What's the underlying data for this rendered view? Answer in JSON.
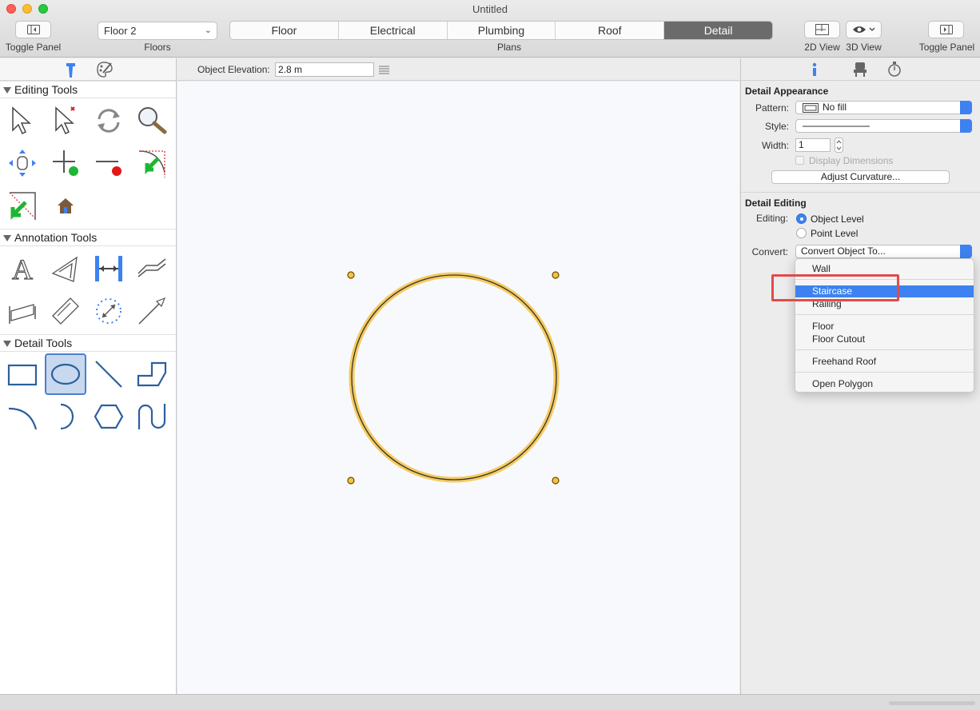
{
  "window": {
    "title": "Untitled"
  },
  "toolbar": {
    "toggle_left_label": "Toggle Panel",
    "floors_label": "Floors",
    "floor_value": "Floor 2",
    "plans_label": "Plans",
    "plans": [
      {
        "label": "Floor",
        "active": false
      },
      {
        "label": "Electrical",
        "active": false
      },
      {
        "label": "Plumbing",
        "active": false
      },
      {
        "label": "Roof",
        "active": false
      },
      {
        "label": "Detail",
        "active": true
      }
    ],
    "view_2d_label": "2D View",
    "view_3d_label": "3D View",
    "toggle_right_label": "Toggle Panel"
  },
  "left_panel": {
    "editing_tools_label": "Editing Tools",
    "annotation_tools_label": "Annotation Tools",
    "detail_tools_label": "Detail Tools",
    "editing_tools": [
      "select-arrow-icon",
      "select-point-icon",
      "rotate-icon",
      "zoom-magnifier-icon",
      "pan-move-icon",
      "add-point-icon",
      "remove-point-icon",
      "join-corner-icon",
      "split-corner-icon",
      "house-icon"
    ],
    "annotation_tools": [
      "text-icon",
      "text-angled-icon",
      "dimension-icon",
      "dimension-aligned-icon",
      "dimension-angle-icon",
      "dimension-slanted-icon",
      "radial-dimension-icon",
      "arrow-line-icon"
    ],
    "detail_tools": [
      "rectangle-icon",
      "ellipse-icon",
      "line-icon",
      "polyline-icon",
      "arc-icon",
      "half-arc-icon",
      "hexagon-icon",
      "curve-icon"
    ],
    "selected_detail_tool": "ellipse-icon"
  },
  "canvas": {
    "elevation_label": "Object Elevation:",
    "elevation_value": "2.8 m"
  },
  "right_panel": {
    "detail_appearance_label": "Detail Appearance",
    "pattern_label": "Pattern:",
    "pattern_value": "No fill",
    "style_label": "Style:",
    "width_label": "Width:",
    "width_value": "1",
    "display_dimensions_label": "Display Dimensions",
    "adjust_curvature_label": "Adjust Curvature...",
    "detail_editing_label": "Detail Editing",
    "editing_label": "Editing:",
    "object_level_label": "Object Level",
    "point_level_label": "Point Level",
    "convert_label": "Convert:",
    "convert_value": "Convert Object To...",
    "accent": "#3d82f0"
  },
  "convert_menu": {
    "items": [
      {
        "label": "Wall"
      },
      {
        "label": "Staircase",
        "highlighted": true
      },
      {
        "label": "Railing"
      },
      {
        "label": "Floor"
      },
      {
        "label": "Floor Cutout"
      },
      {
        "label": "Freehand Roof"
      },
      {
        "label": "Open Polygon"
      }
    ]
  }
}
